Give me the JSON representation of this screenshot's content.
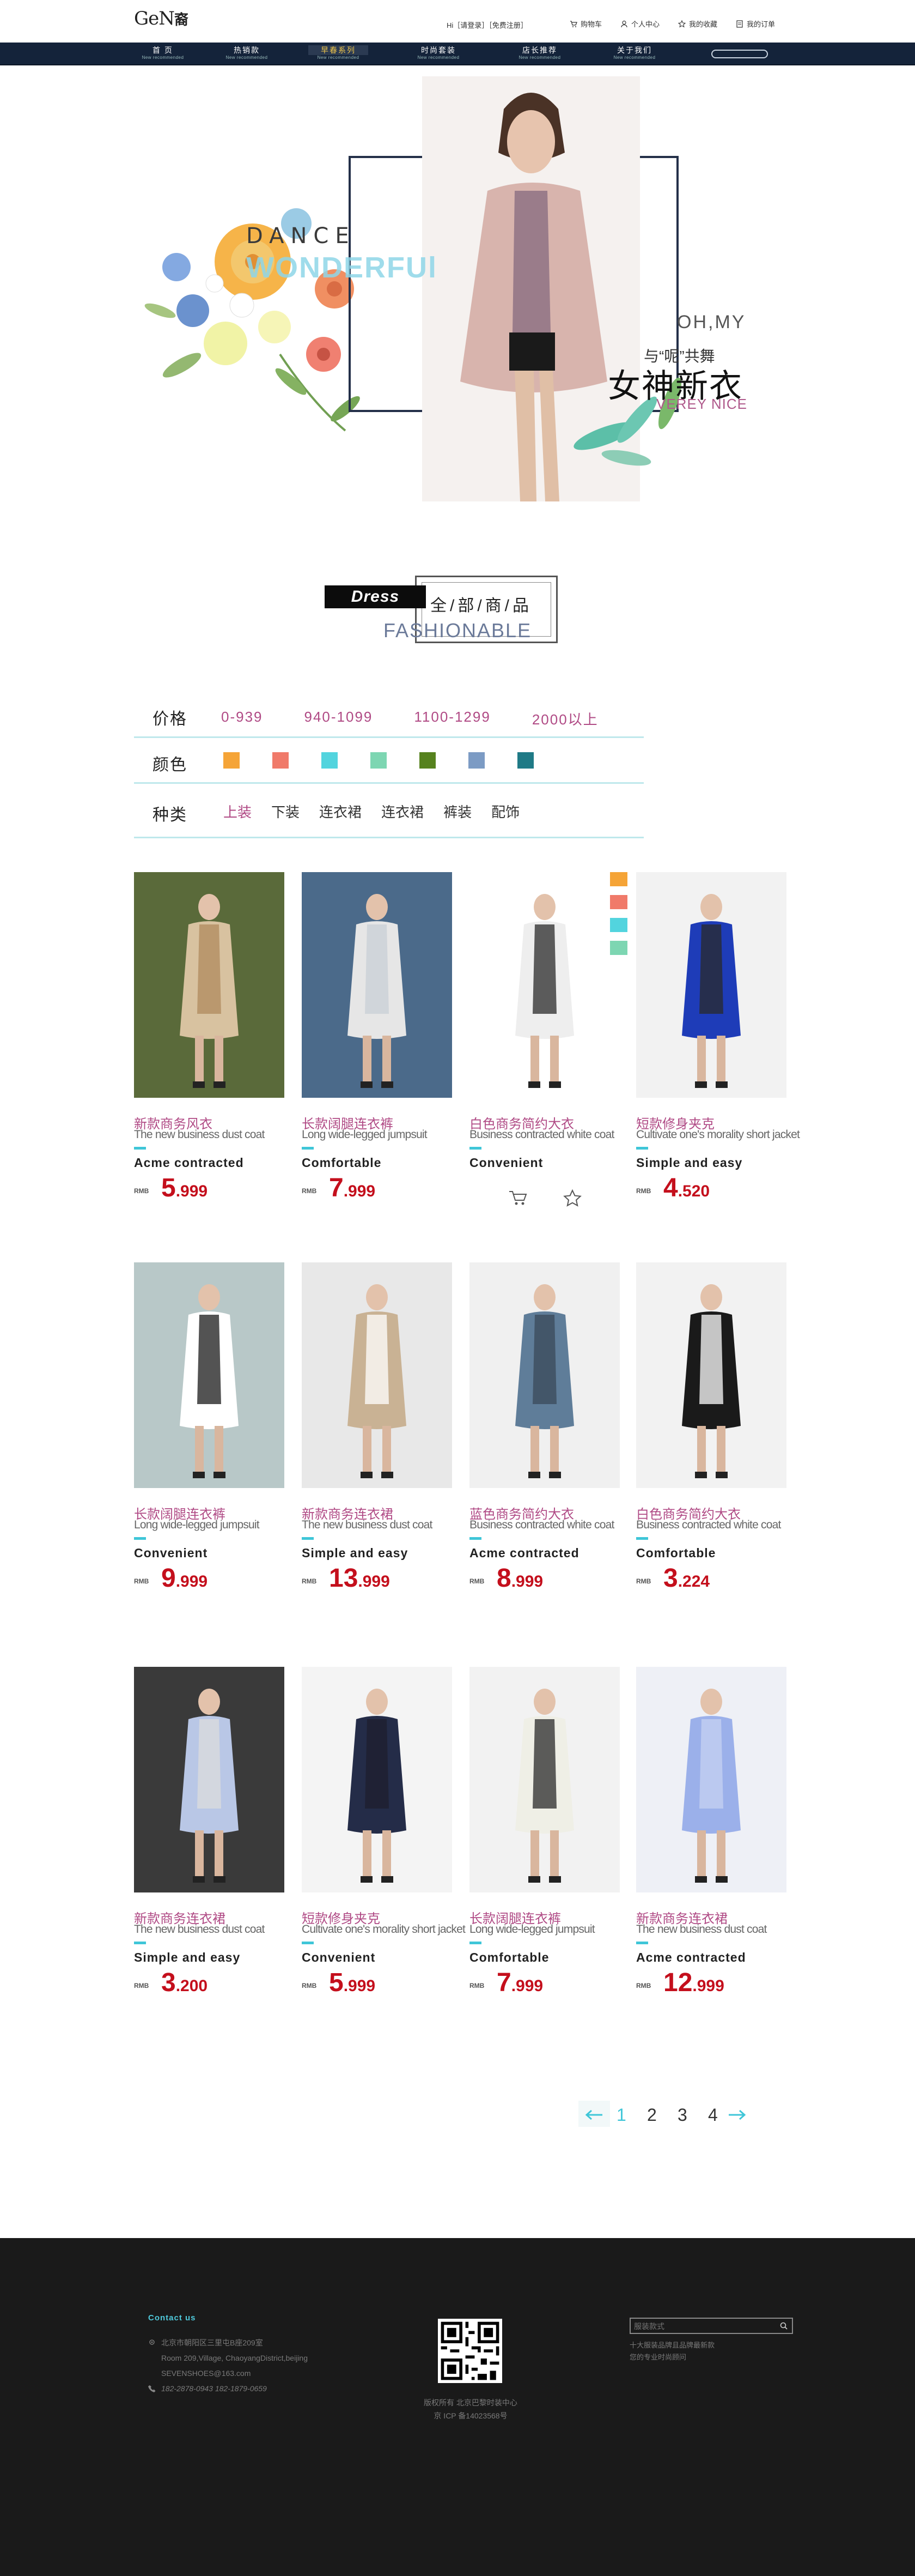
{
  "header": {
    "logo_text": "GeN",
    "logo_cn": "裔",
    "login_text": "Hi［请登录］［免费注册］",
    "links": [
      {
        "label": "购物车",
        "icon": "cart-icon"
      },
      {
        "label": "个人中心",
        "icon": "user-icon"
      },
      {
        "label": "我的收藏",
        "icon": "star-icon"
      },
      {
        "label": "我的订单",
        "icon": "order-icon"
      }
    ]
  },
  "nav": {
    "items": [
      {
        "title": "首 页",
        "sub": "New recommended"
      },
      {
        "title": "热销款",
        "sub": "New recommended"
      },
      {
        "title": "早春系列",
        "sub": "New recommended",
        "active": true
      },
      {
        "title": "时尚套装",
        "sub": "New recommended"
      },
      {
        "title": "店长推荐",
        "sub": "New recommended"
      },
      {
        "title": "关于我们",
        "sub": "New recommended"
      }
    ]
  },
  "hero": {
    "dance": "DANCE",
    "wonderful": "WONDERFUl",
    "ohmy": "OH,MY",
    "tagline": "与“呢”共舞",
    "headline": "女神新衣",
    "verey": "VEREY NICE"
  },
  "section": {
    "dress": "Dress",
    "all": "全/部/商/品",
    "fashion": "FASHIONABLE"
  },
  "filters": {
    "price_label": "价格",
    "prices": [
      "0-939",
      "940-1099",
      "1100-1299",
      "2000以上"
    ],
    "color_label": "颜色",
    "colors": [
      "#f5a437",
      "#f07a6a",
      "#52d4de",
      "#7dd6b2",
      "#56821e",
      "#7c9bc4",
      "#1f7a86"
    ],
    "type_label": "种类",
    "types": [
      "上装",
      "下装",
      "连衣裙",
      "连衣裙",
      "裤装",
      "配饰"
    ]
  },
  "products": [
    {
      "title": "新款商务风衣",
      "sub": "The new business dust coat",
      "name": "Acme contracted",
      "rmb": "RMB",
      "price_big": "5",
      "price_small": ".999"
    },
    {
      "title": "长款阔腿连衣裤",
      "sub": "Long wide-legged jumpsuit",
      "name": "Comfortable",
      "rmb": "RMB",
      "price_big": "7",
      "price_small": ".999"
    },
    {
      "title": "白色商务简约大衣",
      "sub": "Business contracted white coat",
      "name": "Convenient",
      "rmb": "RMB",
      "price_big": "",
      "price_small": ""
    },
    {
      "title": "短款修身夹克",
      "sub": "Cultivate one's morality short jacket",
      "name": "Simple and easy",
      "rmb": "RMB",
      "price_big": "4",
      "price_small": ".520"
    },
    {
      "title": "长款阔腿连衣裤",
      "sub": "Long wide-legged jumpsuit",
      "name": "Convenient",
      "rmb": "RMB",
      "price_big": "9",
      "price_small": ".999"
    },
    {
      "title": "新款商务连衣裙",
      "sub": "The new business dust coat",
      "name": "Simple and easy",
      "rmb": "RMB",
      "price_big": "13",
      "price_small": ".999"
    },
    {
      "title": "蓝色商务简约大衣",
      "sub": "Business contracted white coat",
      "name": "Acme contracted",
      "rmb": "RMB",
      "price_big": "8",
      "price_small": ".999"
    },
    {
      "title": "白色商务简约大衣",
      "sub": "Business contracted white coat",
      "name": "Comfortable",
      "rmb": "RMB",
      "price_big": "3",
      "price_small": ".224"
    },
    {
      "title": "新款商务连衣裙",
      "sub": "The new business dust coat",
      "name": "Simple and easy",
      "rmb": "RMB",
      "price_big": "3",
      "price_small": ".200"
    },
    {
      "title": "短款修身夹克",
      "sub": "Cultivate one's morality short jacket",
      "name": "Convenient",
      "rmb": "RMB",
      "price_big": "5",
      "price_small": ".999"
    },
    {
      "title": "长款阔腿连衣裤",
      "sub": "Long wide-legged jumpsuit",
      "name": "Comfortable",
      "rmb": "RMB",
      "price_big": "7",
      "price_small": ".999"
    },
    {
      "title": "新款商务连衣裙",
      "sub": "The new business dust coat",
      "name": "Acme contracted",
      "rmb": "RMB",
      "price_big": "12",
      "price_small": ".999"
    }
  ],
  "product_swatches": [
    "#f5a437",
    "#f07a6a",
    "#52d4de",
    "#7dd6b2"
  ],
  "pager": {
    "pages": [
      "1",
      "2",
      "3",
      "4"
    ],
    "current": "1"
  },
  "footer": {
    "contact_title": "Contact us",
    "address_cn": "北京市朝阳区三里屯B座209室",
    "address_en": "Room 209,Village, ChaoyangDistrict,beijing",
    "email": "SEVENSHOES@163.com",
    "phone": "182-2878-0943   182-1879-0659",
    "copyright": "版权所有 北京巴黎时装中心",
    "icp": "京 ICP 备14023568号",
    "search_placeholder": "服装款式",
    "tip1": "十大服装品牌且品牌最新款",
    "tip2": "您的专业时尚顾问"
  }
}
